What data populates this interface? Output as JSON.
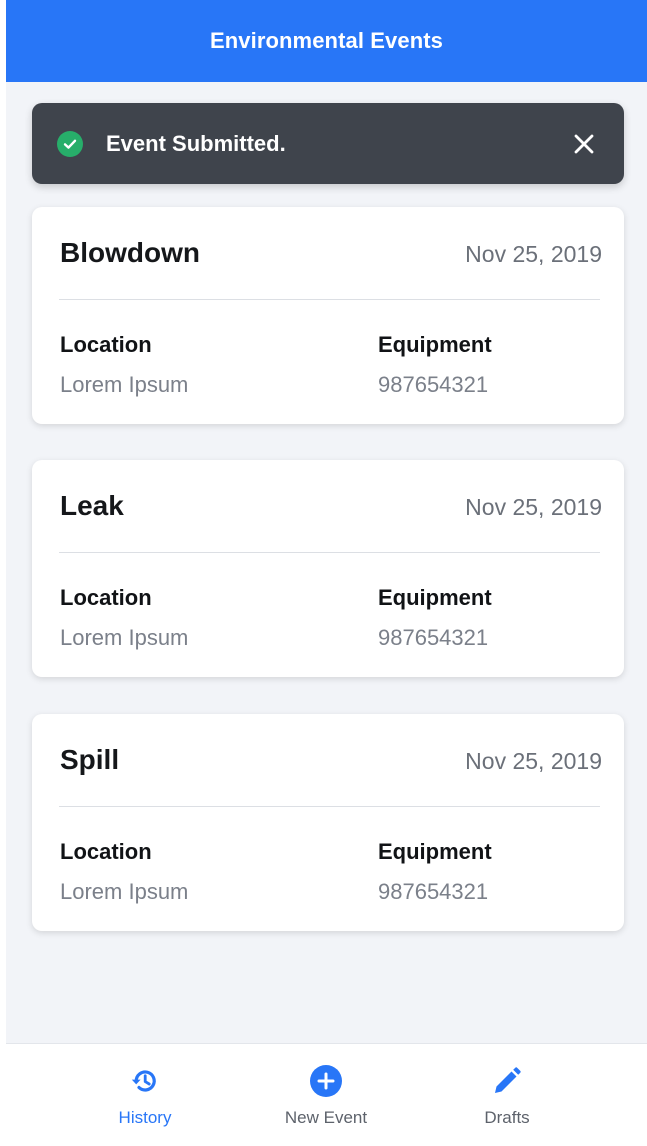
{
  "header": {
    "title": "Environmental Events"
  },
  "toast": {
    "message": "Event Submitted."
  },
  "events": [
    {
      "title": "Blowdown",
      "date": "Nov 25, 2019",
      "location_label": "Location",
      "location_value": "Lorem Ipsum",
      "equipment_label": "Equipment",
      "equipment_value": "987654321"
    },
    {
      "title": "Leak",
      "date": "Nov 25, 2019",
      "location_label": "Location",
      "location_value": "Lorem Ipsum",
      "equipment_label": "Equipment",
      "equipment_value": "987654321"
    },
    {
      "title": "Spill",
      "date": "Nov 25, 2019",
      "location_label": "Location",
      "location_value": "Lorem Ipsum",
      "equipment_label": "Equipment",
      "equipment_value": "987654321"
    }
  ],
  "tabbar": {
    "tabs": [
      {
        "label": "History",
        "icon": "history-icon",
        "active": true
      },
      {
        "label": "New Event",
        "icon": "plus-circle-icon",
        "active": false
      },
      {
        "label": "Drafts",
        "icon": "pencil-icon",
        "active": false
      }
    ]
  },
  "colors": {
    "primary": "#2876f7",
    "toast_bg": "#3f444c",
    "success": "#27ae6a",
    "page_bg": "#f2f4f8"
  }
}
